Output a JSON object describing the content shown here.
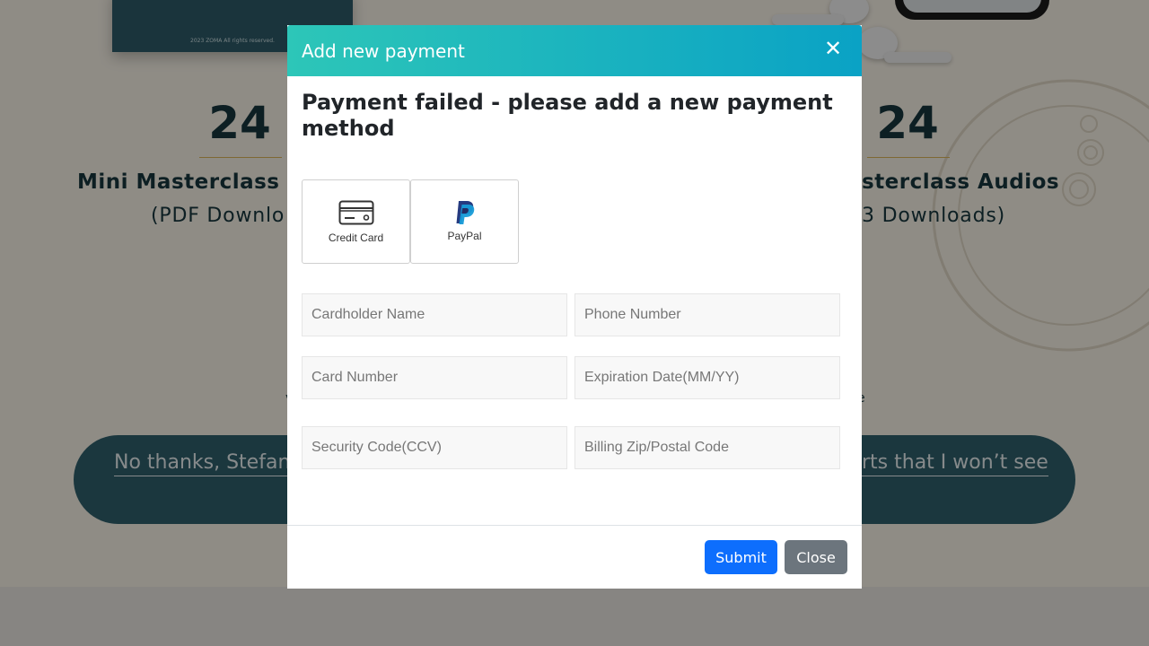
{
  "background_page": {
    "book_copyright": "2023 ZOMA All rights reserved.",
    "stats": [
      {
        "number": "24",
        "title": "Mini Masterclass T",
        "subtitle": "(PDF Downlo"
      },
      {
        "number": "24",
        "title": "sterclass Audios",
        "subtitle": "3 Downloads)"
      }
    ],
    "partial_marks": [
      "v",
      "e"
    ],
    "decline": {
      "left_text": "No thanks, Stefan,",
      "right_text": "rts that I won’t see"
    }
  },
  "modal": {
    "title": "Add new payment",
    "close_icon": "close-icon",
    "error_heading": "Payment failed - please add a new payment method",
    "payment_methods": [
      {
        "label": "Credit Card",
        "icon": "credit-card-icon"
      },
      {
        "label": "PayPal",
        "icon": "paypal-icon"
      }
    ],
    "fields": {
      "cardholder_name": {
        "placeholder": "Cardholder Name",
        "value": ""
      },
      "phone_number": {
        "placeholder": "Phone Number",
        "value": ""
      },
      "card_number": {
        "placeholder": "Card Number",
        "value": ""
      },
      "expiration_date": {
        "placeholder": "Expiration Date(MM/YY)",
        "value": ""
      },
      "security_code": {
        "placeholder": "Security Code(CCV)",
        "value": ""
      },
      "billing_zip": {
        "placeholder": "Billing Zip/Postal Code",
        "value": ""
      }
    },
    "buttons": {
      "submit": "Submit",
      "close": "Close"
    }
  },
  "colors": {
    "header_gradient_start": "#2dc6b8",
    "header_gradient_end": "#0aa2c5",
    "submit": "#0d6efd",
    "close": "#6c757d",
    "page_heading": "#17363d",
    "decline_pill": "#2f5f6b"
  }
}
